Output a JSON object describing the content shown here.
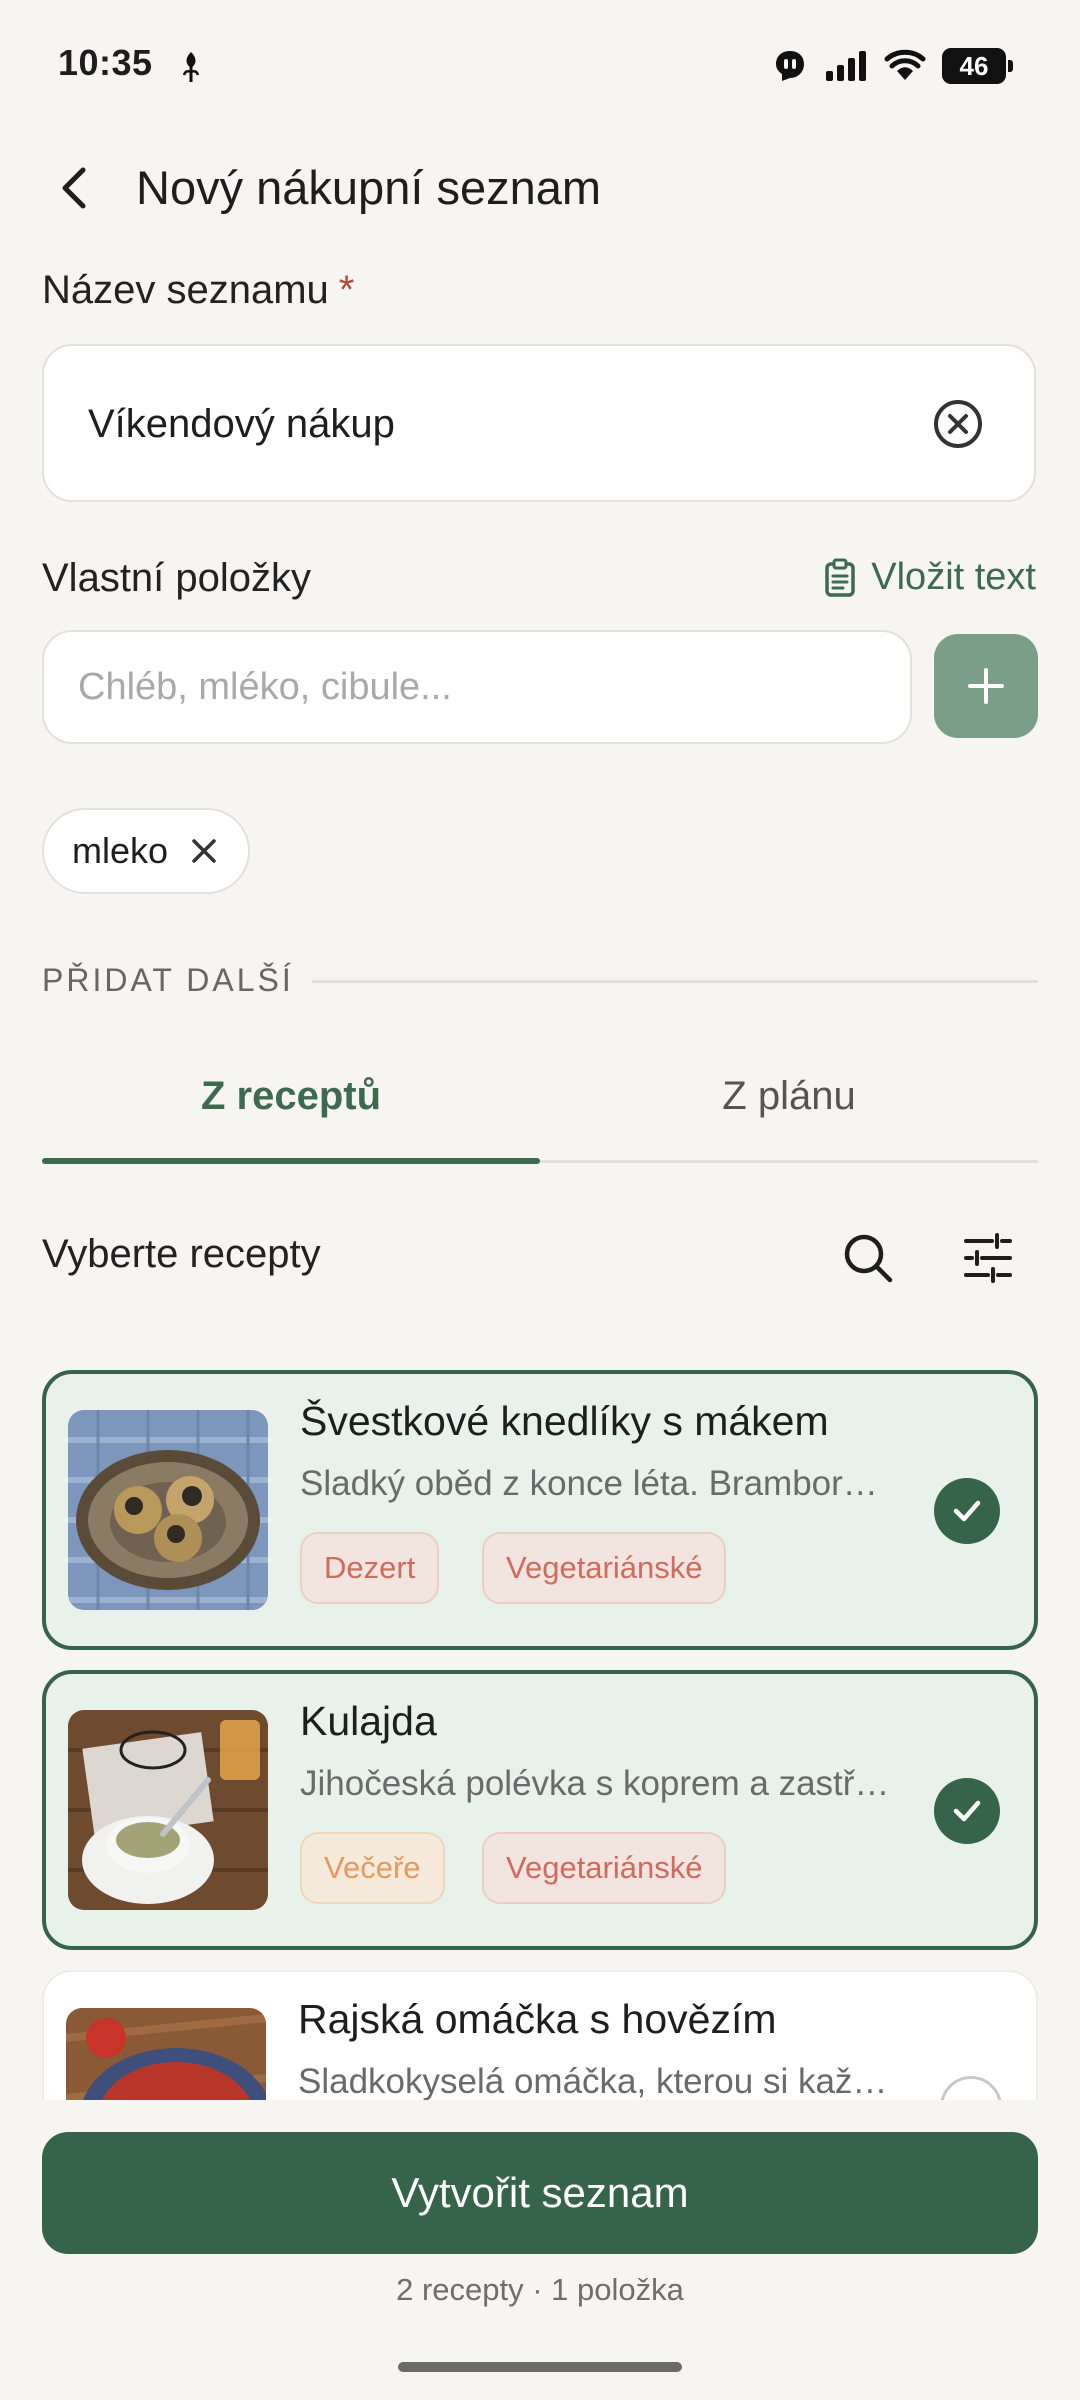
{
  "status_bar": {
    "time": "10:35",
    "battery": "46",
    "icons": [
      "leaf-icon",
      "notification-icon",
      "signal-icon",
      "wifi-icon",
      "battery-icon"
    ]
  },
  "header": {
    "title": "Nový nákupní seznam"
  },
  "list_name": {
    "label": "Název seznamu",
    "required_mark": "*",
    "value": "Víkendový nákup"
  },
  "custom_items": {
    "label": "Vlastní položky",
    "paste_label": "Vložit text",
    "placeholder": "Chléb, mléko, cibule...",
    "chips": [
      {
        "label": "mleko"
      }
    ]
  },
  "add_more": {
    "section_label": "PŘIDAT DALŠÍ",
    "tabs": [
      {
        "label": "Z receptů",
        "active": true
      },
      {
        "label": "Z plánu",
        "active": false
      }
    ],
    "pick_label": "Vyberte recepty"
  },
  "recipes": [
    {
      "title": "Švestkové knedlíky s mákem",
      "description": "Sladký oběd z konce léta. Brambor…",
      "tags": [
        {
          "label": "Dezert"
        },
        {
          "label": "Vegetariánské"
        }
      ],
      "selected": true
    },
    {
      "title": "Kulajda",
      "description": "Jihočeská polévka s koprem a zastř…",
      "tags": [
        {
          "label": "Večeře"
        },
        {
          "label": "Vegetariánské"
        }
      ],
      "selected": true
    },
    {
      "title": "Rajská omáčka s hovězím",
      "description": "Sladkokyselá omáčka, kterou si kaž…",
      "tags": [],
      "selected": false
    }
  ],
  "footer": {
    "create_label": "Vytvořit seznam",
    "summary": "2 recepty · 1 položka"
  },
  "colors": {
    "background": "#F6F5F2",
    "accent": "#35644A",
    "accent_light": "#7A9E87",
    "selected_card": "#E8F2EB",
    "required": "#B4463B",
    "tag_red": "#D06B5D",
    "tag_orange": "#E6995E"
  }
}
